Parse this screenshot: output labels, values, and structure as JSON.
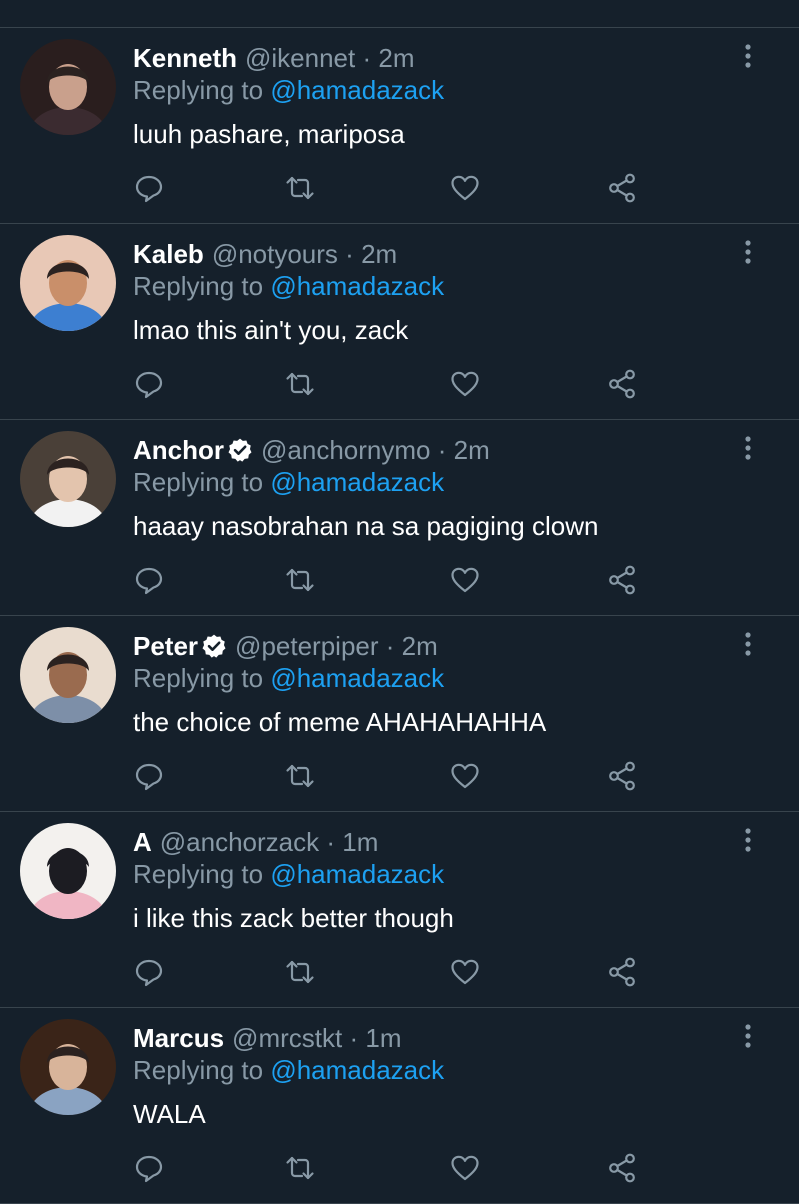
{
  "replies": [
    {
      "name": "Kenneth",
      "verified": false,
      "handle": "@ikennet",
      "sep": "·",
      "time": "2m",
      "replying_prefix": "Replying to",
      "replying_to": "@hamadazack",
      "text": "luuh pashare, mariposa",
      "avatar_colors": [
        "#2a1e1e",
        "#c9a08c",
        "#3b2b30"
      ]
    },
    {
      "name": "Kaleb",
      "verified": false,
      "handle": "@notyours",
      "sep": "·",
      "time": "2m",
      "replying_prefix": "Replying to",
      "replying_to": "@hamadazack",
      "text": "lmao this ain't you, zack",
      "avatar_colors": [
        "#e8c8b6",
        "#c98f6a",
        "#3d7fd1"
      ]
    },
    {
      "name": "Anchor",
      "verified": true,
      "handle": "@anchornymo",
      "sep": "·",
      "time": "2m",
      "replying_prefix": "Replying to",
      "replying_to": "@hamadazack",
      "text": "haaay nasobrahan na sa pagiging clown",
      "avatar_colors": [
        "#4a4038",
        "#e3c4ad",
        "#f2f2f2"
      ]
    },
    {
      "name": "Peter",
      "verified": true,
      "handle": "@peterpiper",
      "sep": "·",
      "time": "2m",
      "replying_prefix": "Replying to",
      "replying_to": "@hamadazack",
      "text": "the choice of meme AHAHAHAHHA",
      "avatar_colors": [
        "#e9dccf",
        "#9a6b4f",
        "#7d8fa8"
      ]
    },
    {
      "name": "A",
      "verified": false,
      "handle": "@anchorzack",
      "sep": "·",
      "time": "1m",
      "replying_prefix": "Replying to",
      "replying_to": "@hamadazack",
      "text": "i like this zack better though",
      "avatar_colors": [
        "#f3f1ee",
        "#1c1c22",
        "#f0b6c4"
      ]
    },
    {
      "name": "Marcus",
      "verified": false,
      "handle": "@mrcstkt",
      "sep": "·",
      "time": "1m",
      "replying_prefix": "Replying to",
      "replying_to": "@hamadazack",
      "text": "WALA",
      "avatar_colors": [
        "#3a2418",
        "#d8b49a",
        "#8aa3c2"
      ]
    }
  ],
  "theme": {
    "background": "#15202b",
    "divider": "#38444d",
    "secondary_text": "#8899a6",
    "link": "#1da1f2",
    "primary_text": "#ffffff"
  },
  "icons": {
    "reply": "reply-icon",
    "retweet": "retweet-icon",
    "like": "like-icon",
    "share": "share-icon",
    "more": "more-vertical-icon",
    "verified": "verified-badge-icon"
  }
}
